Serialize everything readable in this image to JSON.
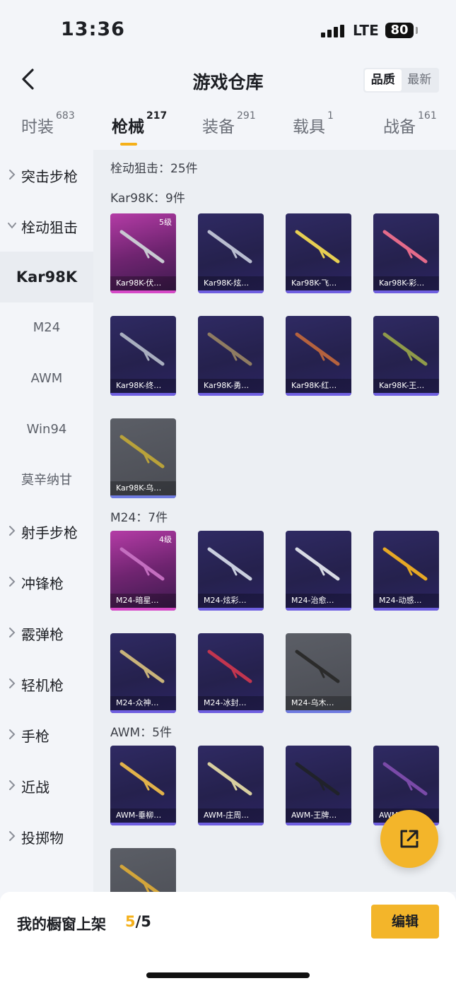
{
  "status_bar": {
    "time": "13:36",
    "network": "LTE",
    "battery": "80"
  },
  "header": {
    "title": "游戏仓库",
    "sort_quality": "品质",
    "sort_latest": "最新"
  },
  "tabs": [
    {
      "label": "时装",
      "count": "683"
    },
    {
      "label": "枪械",
      "count": "217"
    },
    {
      "label": "装备",
      "count": "291"
    },
    {
      "label": "载具",
      "count": "1"
    },
    {
      "label": "战备",
      "count": "161"
    }
  ],
  "sidebar": {
    "cat_assault": "突击步枪",
    "cat_bolt": "栓动狙击",
    "sub_kar98k": "Kar98K",
    "sub_m24": "M24",
    "sub_awm": "AWM",
    "sub_win94": "Win94",
    "sub_mosin": "莫辛纳甘",
    "cat_marksman": "射手步枪",
    "cat_smg": "冲锋枪",
    "cat_shotgun": "霰弹枪",
    "cat_lmg": "轻机枪",
    "cat_pistol": "手枪",
    "cat_melee": "近战",
    "cat_throw": "投掷物"
  },
  "content": {
    "category_title": "栓动狙击：25件",
    "kar98k_title": "Kar98K：9件",
    "m24_title": "M24：7件",
    "awm_title": "AWM：5件",
    "kar98k_items": [
      {
        "name": "Kar98K-伏…",
        "level": "5级",
        "color": "#c9c9d2"
      },
      {
        "name": "Kar98K-炫…",
        "color": "#b9bdd0"
      },
      {
        "name": "Kar98K-飞…",
        "color": "#e7cf52"
      },
      {
        "name": "Kar98K-彩…",
        "color": "#e56b8a"
      },
      {
        "name": "Kar98K-终…",
        "color": "#a8aebf"
      },
      {
        "name": "Kar98K-勇…",
        "color": "#8f7c62"
      },
      {
        "name": "Kar98K-红…",
        "color": "#b5623e"
      },
      {
        "name": "Kar98K-王…",
        "color": "#8f9a4a"
      },
      {
        "name": "Kar98K-乌…",
        "color": "#b9a23a"
      }
    ],
    "m24_items": [
      {
        "name": "M24-暗星…",
        "level": "4级",
        "color": "#c46ec0"
      },
      {
        "name": "M24-炫彩…",
        "color": "#c9cede"
      },
      {
        "name": "M24-治愈…",
        "color": "#d7dae4"
      },
      {
        "name": "M24-动感…",
        "color": "#e6a825"
      },
      {
        "name": "M24-众神…",
        "color": "#c9b37a"
      },
      {
        "name": "M24-冰封…",
        "color": "#c2354f"
      },
      {
        "name": "M24-乌木…",
        "color": "#2b2b2b"
      }
    ],
    "awm_items": [
      {
        "name": "AWM-垂柳…",
        "color": "#e2b24a"
      },
      {
        "name": "AWM-庄周…",
        "color": "#d8cfa0"
      },
      {
        "name": "AWM-王牌…",
        "color": "#20222a"
      },
      {
        "name": "AWM-…",
        "color": "#7a4aa8"
      },
      {
        "name": "",
        "color": "#d3a53a"
      }
    ]
  },
  "bottom": {
    "label": "我的橱窗上架",
    "count_current": "5",
    "count_total": "/5",
    "edit_label": "编辑"
  }
}
